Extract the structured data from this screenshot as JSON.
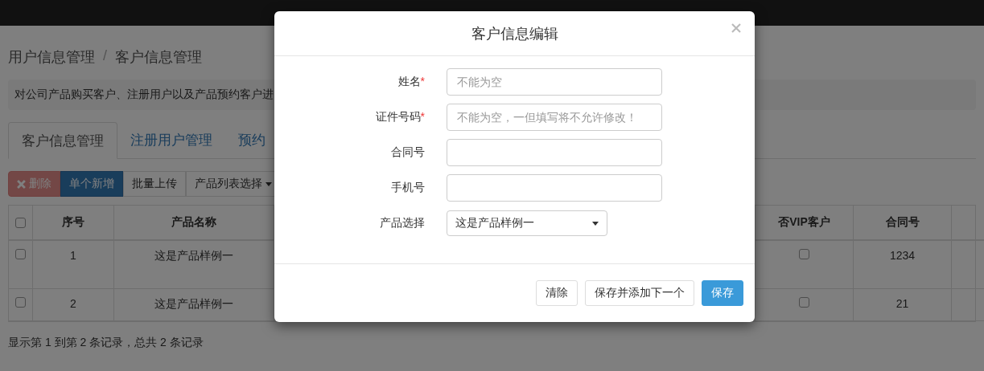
{
  "breadcrumb": [
    "用户信息管理",
    "/",
    "客户信息管理"
  ],
  "notice": "对公司产品购买客户、注册用户以及产品预约客户进",
  "tabs": [
    {
      "label": "客户信息管理",
      "selected": true
    },
    {
      "label": "注册用户管理",
      "selected": false
    },
    {
      "label": "预约",
      "selected": false
    }
  ],
  "toolbar": [
    {
      "label": "删除",
      "kind": "danger",
      "disabled": true
    },
    {
      "label": "单个新增",
      "kind": "primary",
      "disabled": false
    },
    {
      "label": "批量上传",
      "kind": "default",
      "disabled": false
    },
    {
      "label": "产品列表选择",
      "kind": "dropdown",
      "disabled": false
    }
  ],
  "table": {
    "header_checked": false,
    "left_columns": [
      "序号",
      "产品名称"
    ],
    "right_columns": [
      "否VIP客户",
      "合同号"
    ],
    "rows": [
      {
        "checked": false,
        "number": "1",
        "product": "这是产品样例一",
        "vip": false,
        "contract": "1234",
        "tall": true
      },
      {
        "checked": false,
        "number": "2",
        "product": "这是产品样例一",
        "vip": false,
        "contract": "21",
        "tall": false
      }
    ]
  },
  "pagination_info": "显示第 1 到第 2 条记录，总共 2 条记录",
  "modal": {
    "title": "客户信息编辑",
    "fields": [
      {
        "kind": "input",
        "label": "姓名",
        "required_mark": "*",
        "placeholder": "不能为空"
      },
      {
        "kind": "input",
        "label": "证件号码",
        "required_mark": "*",
        "placeholder": "不能为空，一但填写将不允许修改！"
      },
      {
        "kind": "input",
        "label": "合同号"
      },
      {
        "kind": "input",
        "label": "手机号"
      },
      {
        "kind": "select",
        "label": "产品选择",
        "value": "这是产品样例一"
      }
    ],
    "buttons": [
      {
        "label": "清除",
        "kind": "default"
      },
      {
        "label": "保存并添加下一个",
        "kind": "default"
      },
      {
        "label": "保存",
        "kind": "primary"
      }
    ]
  }
}
